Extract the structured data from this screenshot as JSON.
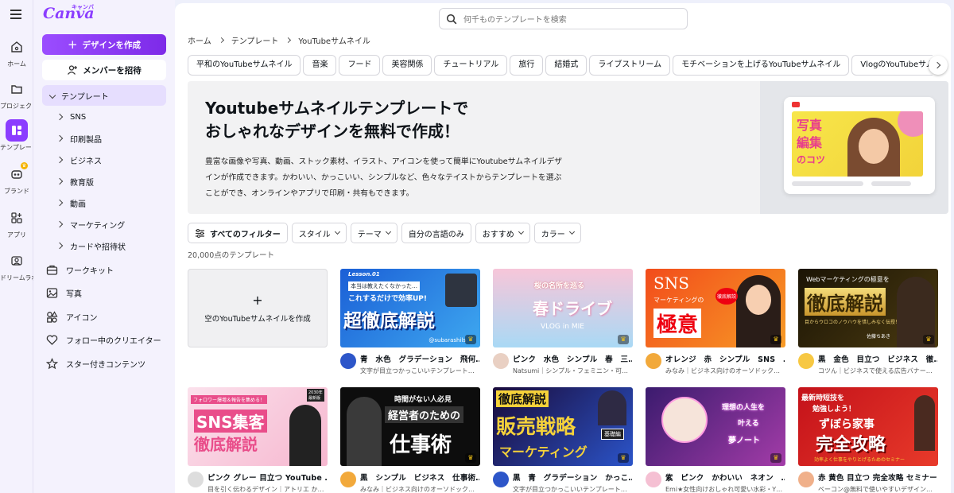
{
  "rail": {
    "items": [
      {
        "label": "ホーム",
        "icon": "home-icon"
      },
      {
        "label": "プロジェクト",
        "icon": "folder-icon"
      },
      {
        "label": "テンプレート",
        "icon": "template-icon"
      },
      {
        "label": "ブランド",
        "icon": "brand-icon"
      },
      {
        "label": "アプリ",
        "icon": "apps-icon"
      },
      {
        "label": "ドリームラボ",
        "icon": "dream-lab-icon"
      }
    ]
  },
  "sidebar": {
    "logo": "Canva",
    "logo_sub": "キャンバ",
    "create_button": "デザインを作成",
    "invite_button": "メンバーを招待",
    "templates_label": "テンプレート",
    "template_categories": [
      "SNS",
      "印刷製品",
      "ビジネス",
      "教育版",
      "動画",
      "マーケティング",
      "カードや招待状"
    ],
    "nav": [
      {
        "label": "ワークキット",
        "icon": "briefcase-icon"
      },
      {
        "label": "写真",
        "icon": "photo-icon"
      },
      {
        "label": "アイコン",
        "icon": "shapes-icon"
      },
      {
        "label": "フォロー中のクリエイター",
        "icon": "heart-icon"
      },
      {
        "label": "スター付きコンテンツ",
        "icon": "star-icon"
      }
    ]
  },
  "search": {
    "placeholder": "何千ものテンプレートを検索"
  },
  "breadcrumb": [
    "ホーム",
    "テンプレート",
    "YouTubeサムネイル"
  ],
  "chips": [
    "平和のYouTubeサムネイル",
    "音楽",
    "フード",
    "美容関係",
    "チュートリアル",
    "旅行",
    "結婚式",
    "ライブストリーム",
    "モチベーションを上げるYouTubeサムネイル",
    "VlogのYouTubeサムネイル"
  ],
  "hero": {
    "title_line1": "Youtubeサムネイルテンプレートで",
    "title_line2": "おしゃれなデザインを無料で作成！",
    "description": "豊富な画像や写真、動画、ストック素材、イラスト、アイコンを使って簡単にYoutubeサムネイルデザインが作成できます。かわいい、かっこいい、シンプルなど、色々なテイストからテンプレートを選ぶことができ、オンラインやアプリで印刷・共有もできます。",
    "image_text1": "写真",
    "image_text2": "編集",
    "image_text3": "のコツ"
  },
  "filters": {
    "all": "すべてのフィルター",
    "items": [
      "スタイル",
      "テーマ",
      "自分の言語のみ",
      "おすすめ",
      "カラー"
    ]
  },
  "count": "20,000点のテンプレート",
  "blank_card": "空のYouTubeサムネイルを作成",
  "cards": [
    {
      "title": "青　水色　グラデーション　飛何…",
      "creator": "文字が目立つかっこいいテンプレート…",
      "thumb_lines": [
        "Lesson.01",
        "本当は教えたくなかった…",
        "これするだけで効率UP!",
        "超徹底解説",
        "@subarashils"
      ]
    },
    {
      "title": "ピンク　水色　シンプル　春　三…",
      "creator": "Natsumi｜シンプル・フェミニン・可…",
      "thumb_lines": [
        "桜の名所を巡る",
        "春ドライブ",
        "VLOG in MIE"
      ]
    },
    {
      "title": "オレンジ　赤　シンプル　SNS　…",
      "creator": "みなみ｜ビジネス向けのオーソドック…",
      "thumb_lines": [
        "SNS",
        "マーケティングの",
        "極意",
        "徹底解説"
      ]
    },
    {
      "title": "黒　金色　目立つ　ビジネス　徹…",
      "creator": "コツん｜ビジネスで使える広告バナー…",
      "thumb_lines": [
        "Webマーケティングの極意を",
        "徹底解説",
        "目からウロコのノウハウを惜しみなく伝授！",
        "佐藤ちあき"
      ]
    },
    {
      "title": "ピンク グレー 目立つ YouTube …",
      "creator": "目を引く伝わるデザイン｜アトリエ か…",
      "thumb_lines": [
        "フォロワー爆増＆報告を集める！",
        "2030年最新版",
        "SNS集客",
        "徹底解説"
      ]
    },
    {
      "title": "黒　シンプル　ビジネス　仕事術…",
      "creator": "みなみ｜ビジネス向けのオーソドック…",
      "thumb_lines": [
        "時間がない人必見",
        "経営者のための",
        "仕事術"
      ]
    },
    {
      "title": "黒　青　グラデーション　かっこ…",
      "creator": "文字が目立つかっこいいテンプレート…",
      "thumb_lines": [
        "徹底解説",
        "販売戦略",
        "マーケティング",
        "基礎編"
      ]
    },
    {
      "title": "紫　ピンク　かわいい　ネオン　…",
      "creator": "Emi★女性向けおしゃれ可愛い水彩・Y…",
      "thumb_lines": [
        "理想の人生を",
        "叶える",
        "夢ノート"
      ]
    },
    {
      "title": "赤 黄色 目立つ 完全攻略 セミナー…",
      "creator": "ベーコン@無料で使いやすいデザイン…",
      "thumb_lines": [
        "最新時短技を",
        "勉強しよう！",
        "ずぼら家事",
        "完全攻略",
        "効率よく仕事をやりとげるためのセミナー"
      ]
    }
  ],
  "colors": {
    "accent": "#8b3dff",
    "sidebar_bg": "#f4f2fd",
    "selected_bg": "#e6defe"
  }
}
